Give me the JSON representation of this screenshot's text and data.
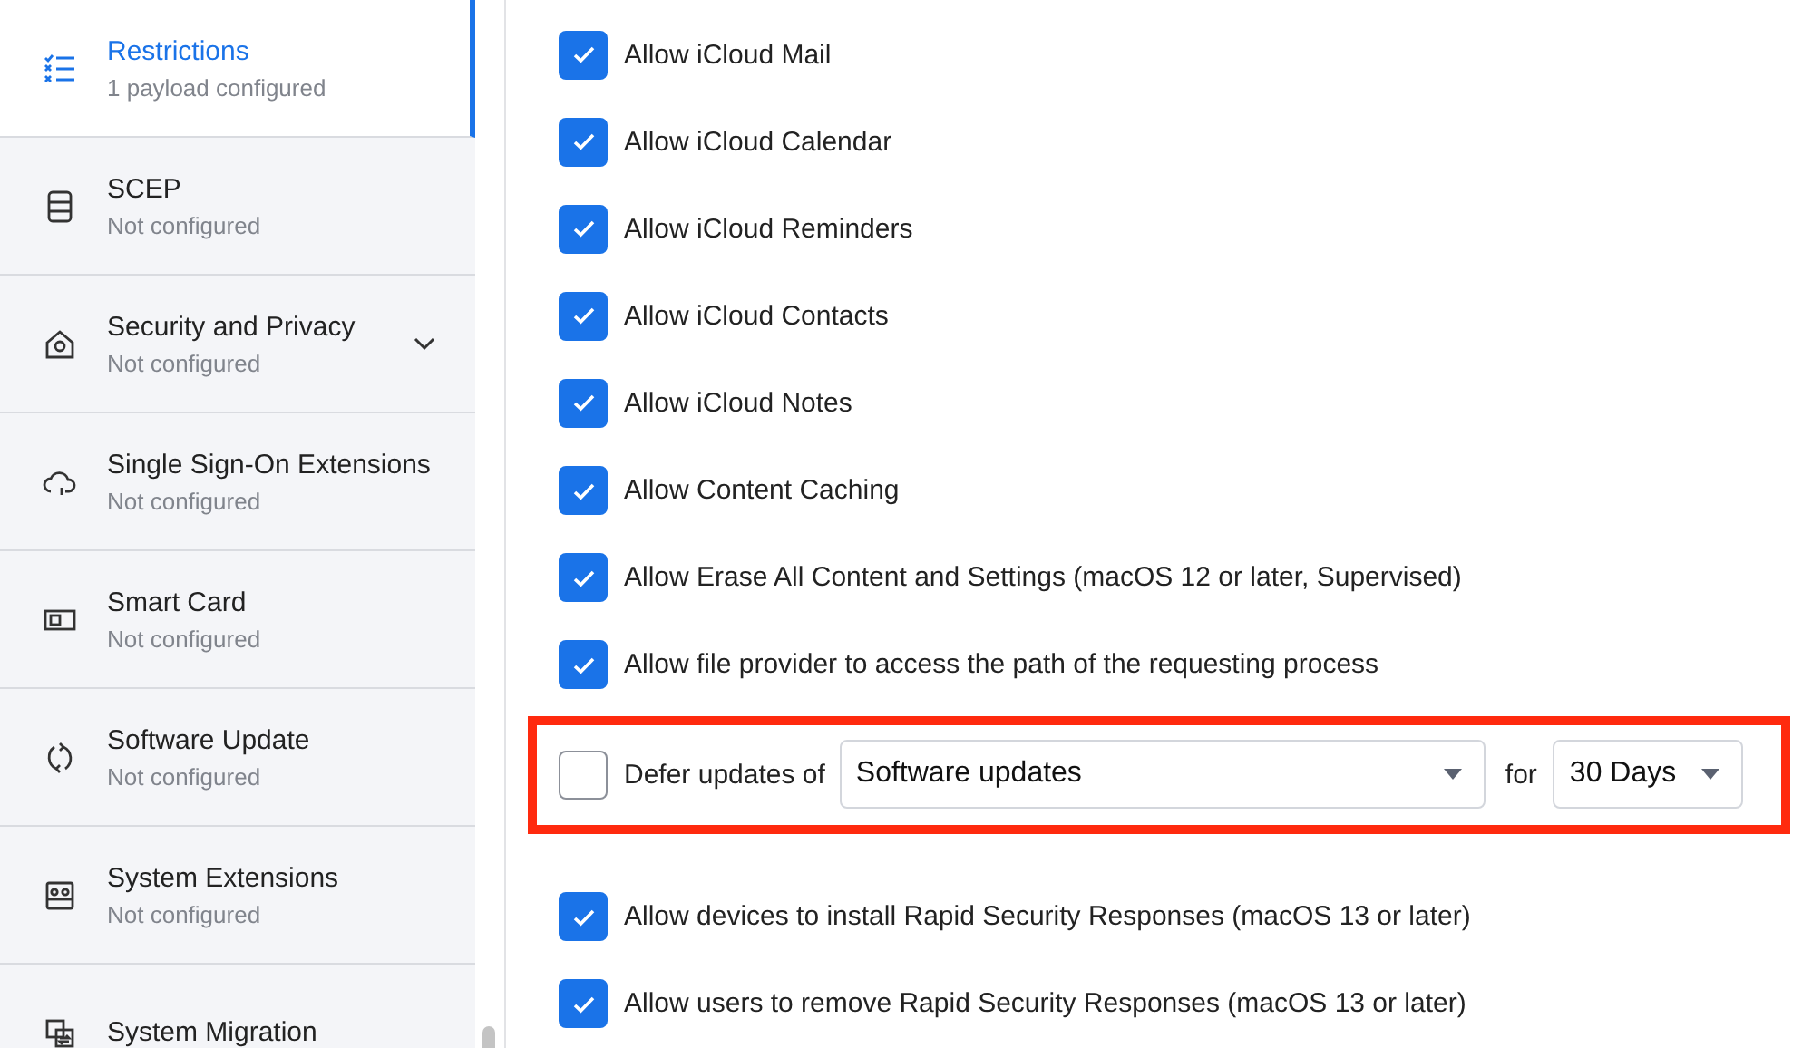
{
  "sidebar": {
    "items": [
      {
        "title": "Restrictions",
        "subtitle": "1 payload configured",
        "selected": true,
        "expandable": false
      },
      {
        "title": "SCEP",
        "subtitle": "Not configured",
        "selected": false,
        "expandable": false
      },
      {
        "title": "Security and Privacy",
        "subtitle": "Not configured",
        "selected": false,
        "expandable": true
      },
      {
        "title": "Single Sign-On Extensions",
        "subtitle": "Not configured",
        "selected": false,
        "expandable": false
      },
      {
        "title": "Smart Card",
        "subtitle": "Not configured",
        "selected": false,
        "expandable": false
      },
      {
        "title": "Software Update",
        "subtitle": "Not configured",
        "selected": false,
        "expandable": false
      },
      {
        "title": "System Extensions",
        "subtitle": "Not configured",
        "selected": false,
        "expandable": false
      },
      {
        "title": "System Migration",
        "selected": false,
        "expandable": false
      }
    ]
  },
  "options": [
    {
      "kind": "checkbox",
      "label": "Allow iCloud Mail",
      "checked": true
    },
    {
      "kind": "checkbox",
      "label": "Allow iCloud Calendar",
      "checked": true
    },
    {
      "kind": "checkbox",
      "label": "Allow iCloud Reminders",
      "checked": true
    },
    {
      "kind": "checkbox",
      "label": "Allow iCloud Contacts",
      "checked": true
    },
    {
      "kind": "checkbox",
      "label": "Allow iCloud Notes",
      "checked": true
    },
    {
      "kind": "checkbox",
      "label": "Allow Content Caching",
      "checked": true
    },
    {
      "kind": "checkbox",
      "label": "Allow Erase All Content and Settings (macOS 12 or later, Supervised)",
      "checked": true
    },
    {
      "kind": "checkbox",
      "label": "Allow file provider to access the path of the requesting process",
      "checked": true
    },
    {
      "kind": "defer",
      "label": "Defer updates of",
      "checked": false,
      "highlighted": true,
      "select": "Software updates",
      "joiner": "for",
      "period": "30 Days"
    },
    {
      "kind": "checkbox",
      "label": "Allow devices to install Rapid Security Responses (macOS 13 or later)",
      "checked": true
    },
    {
      "kind": "checkbox",
      "label": "Allow users to remove Rapid Security Responses (macOS 13 or later)",
      "checked": true
    }
  ]
}
